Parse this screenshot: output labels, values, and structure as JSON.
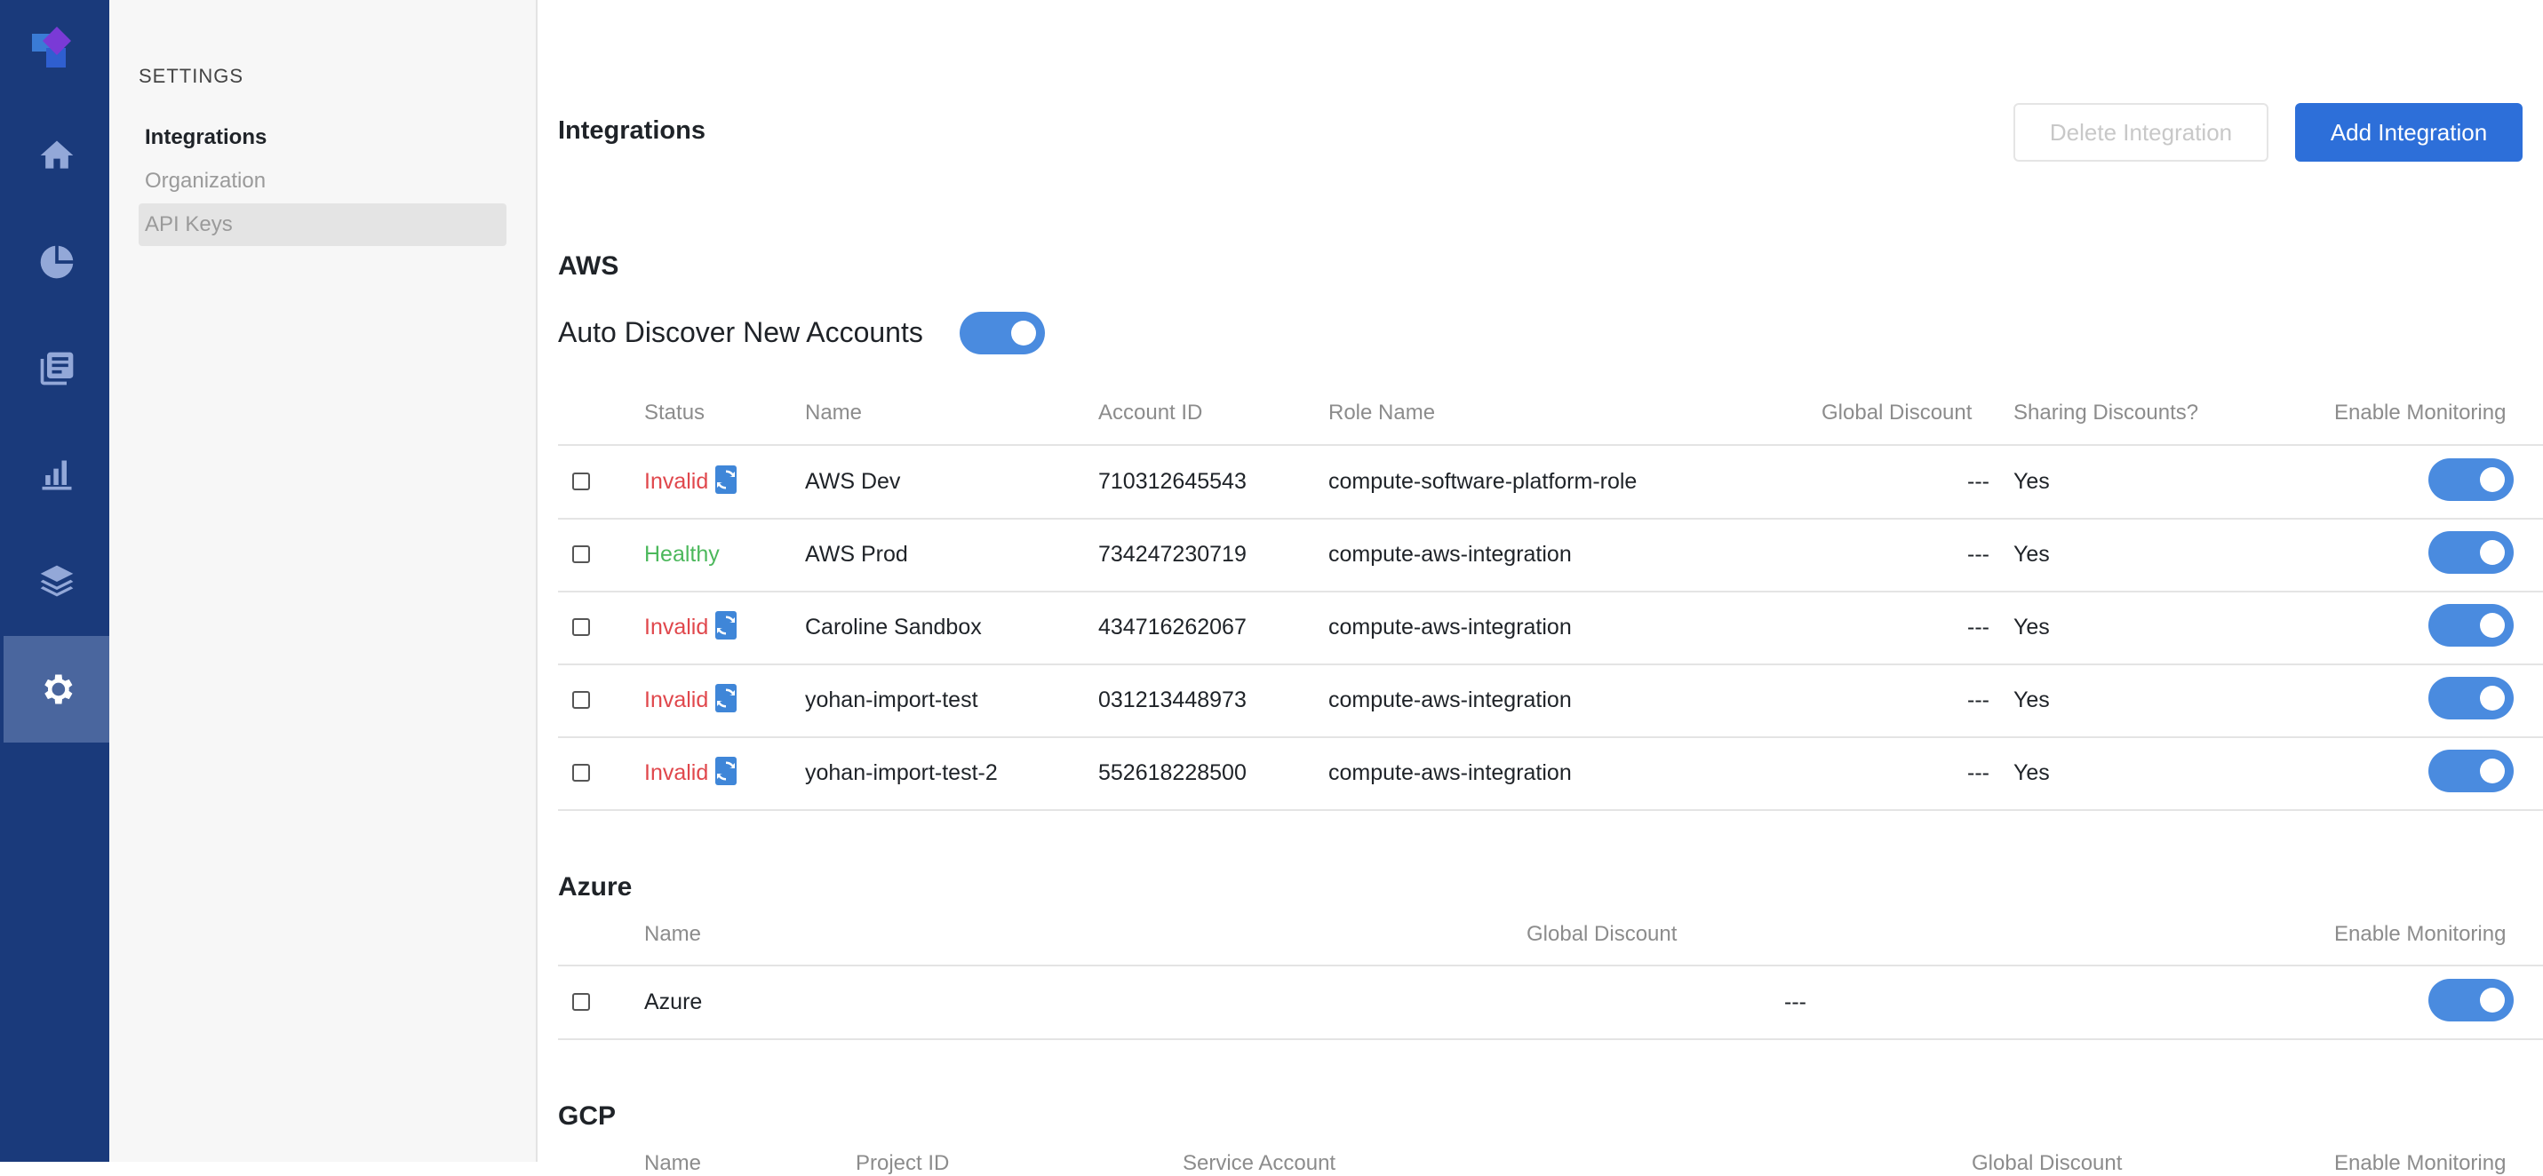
{
  "nav": {
    "icons": [
      "logo-icon",
      "home-icon",
      "pie-chart-icon",
      "documents-icon",
      "bar-chart-icon",
      "layers-icon",
      "gear-icon"
    ]
  },
  "settings": {
    "caption": "SETTINGS",
    "items": [
      {
        "label": "Integrations",
        "state": "active"
      },
      {
        "label": "Organization",
        "state": "normal"
      },
      {
        "label": "API Keys",
        "state": "hover"
      }
    ]
  },
  "page": {
    "title": "Integrations",
    "delete_label": "Delete Integration",
    "add_label": "Add Integration"
  },
  "colors": {
    "accent": "#2d6fd9",
    "toggle": "#4a8bdf",
    "rail": "#1a3a7b",
    "invalid": "#e0474c",
    "healthy": "#4cb85c"
  },
  "aws": {
    "title": "AWS",
    "auto_discover_label": "Auto Discover New Accounts",
    "auto_discover_on": true,
    "columns": [
      "Status",
      "Name",
      "Account ID",
      "Role Name",
      "Global Discount",
      "Sharing Discounts?",
      "Enable Monitoring"
    ],
    "rows": [
      {
        "status": "Invalid",
        "name": "AWS Dev",
        "account_id": "710312645543",
        "role": "compute-software-platform-role",
        "discount": "---",
        "sharing": "Yes",
        "monitoring": true
      },
      {
        "status": "Healthy",
        "name": "AWS Prod",
        "account_id": "734247230719",
        "role": "compute-aws-integration",
        "discount": "---",
        "sharing": "Yes",
        "monitoring": true
      },
      {
        "status": "Invalid",
        "name": "Caroline Sandbox",
        "account_id": "434716262067",
        "role": "compute-aws-integration",
        "discount": "---",
        "sharing": "Yes",
        "monitoring": true
      },
      {
        "status": "Invalid",
        "name": "yohan-import-test",
        "account_id": "031213448973",
        "role": "compute-aws-integration",
        "discount": "---",
        "sharing": "Yes",
        "monitoring": true
      },
      {
        "status": "Invalid",
        "name": "yohan-import-test-2",
        "account_id": "552618228500",
        "role": "compute-aws-integration",
        "discount": "---",
        "sharing": "Yes",
        "monitoring": true
      }
    ]
  },
  "azure": {
    "title": "Azure",
    "columns": [
      "Name",
      "Global Discount",
      "Enable Monitoring"
    ],
    "rows": [
      {
        "name": "Azure",
        "discount": "---",
        "monitoring": true
      }
    ]
  },
  "gcp": {
    "title": "GCP",
    "columns": [
      "Name",
      "Project ID",
      "Service Account",
      "Global Discount",
      "Enable Monitoring"
    ]
  }
}
